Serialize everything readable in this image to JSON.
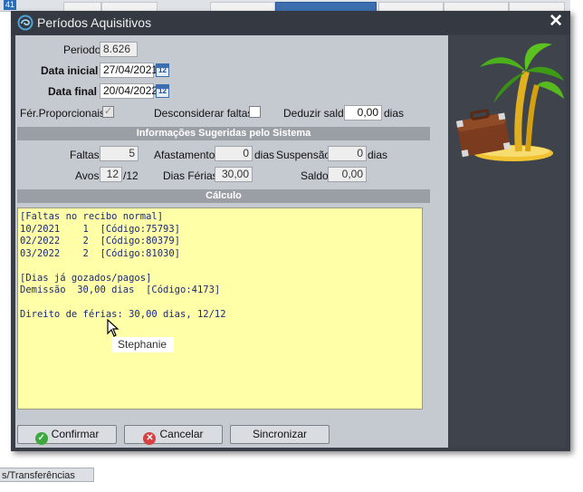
{
  "background": {
    "top_badge": "41",
    "bottom_tab_label": "s/Transferências"
  },
  "window": {
    "title": "Períodos Aquisitivos",
    "close_glyph": "✕"
  },
  "form": {
    "periodo_label": "Periodo",
    "periodo_value": "8.626",
    "data_inicial_label": "Data inicial",
    "data_inicial_value": "27/04/2021",
    "data_final_label": "Data final",
    "data_final_value": "20/04/2022",
    "calendar_glyph": "12",
    "fer_proporcionais_label": "Fér.Proporcionais",
    "fer_proporcionais_checked": true,
    "check_glyph": "✓",
    "desconsiderar_faltas_label": "Desconsiderar faltas",
    "desconsiderar_faltas_checked": false,
    "deduzir_saldo_label": "Deduzir saldo",
    "deduzir_saldo_value": "0,00",
    "deduzir_saldo_unit": "dias"
  },
  "sugeridas": {
    "header": "Informações Sugeridas pelo Sistema",
    "faltas_label": "Faltas",
    "faltas_value": "5",
    "afastamento_label": "Afastamento",
    "afastamento_value": "0",
    "afastamento_unit": "dias",
    "suspensao_label": "Suspensão",
    "suspensao_value": "0",
    "suspensao_unit": "dias",
    "avos_label": "Avos",
    "avos_value": "12",
    "avos_total": "/12",
    "dias_ferias_label": "Dias Férias",
    "dias_ferias_value": "30,00",
    "saldo_label": "Saldo",
    "saldo_value": "0,00"
  },
  "calculo": {
    "header": "Cálculo",
    "lines": [
      "[Faltas no recibo normal]",
      "10/2021    1  [Código:75793]",
      "02/2022    2  [Código:80379]",
      "03/2022    2  [Código:81030]",
      "",
      "[Dias já gozados/pagos]",
      "Demissão  30,00 dias  [Código:4173]",
      "",
      "Direito de férias: 30,00 dias, 12/12"
    ]
  },
  "buttons": {
    "confirmar": "Confirmar",
    "cancelar": "Cancelar",
    "sincronizar": "Sincronizar"
  },
  "tooltip": "Stephanie",
  "icons": {
    "title": "app-swirl-icon",
    "calendar": "calendar-icon",
    "confirm": "check-circle-icon",
    "cancel": "x-circle-icon",
    "illustration": "palm-island-suitcase-icon",
    "cursor": "mouse-pointer-icon"
  },
  "colors": {
    "window_dark": "#353a42",
    "form_bg": "#c5c9d0",
    "memo_bg": "#ffffa8",
    "memo_text": "#1a2a78",
    "section_bar": "#9a9ea5"
  }
}
